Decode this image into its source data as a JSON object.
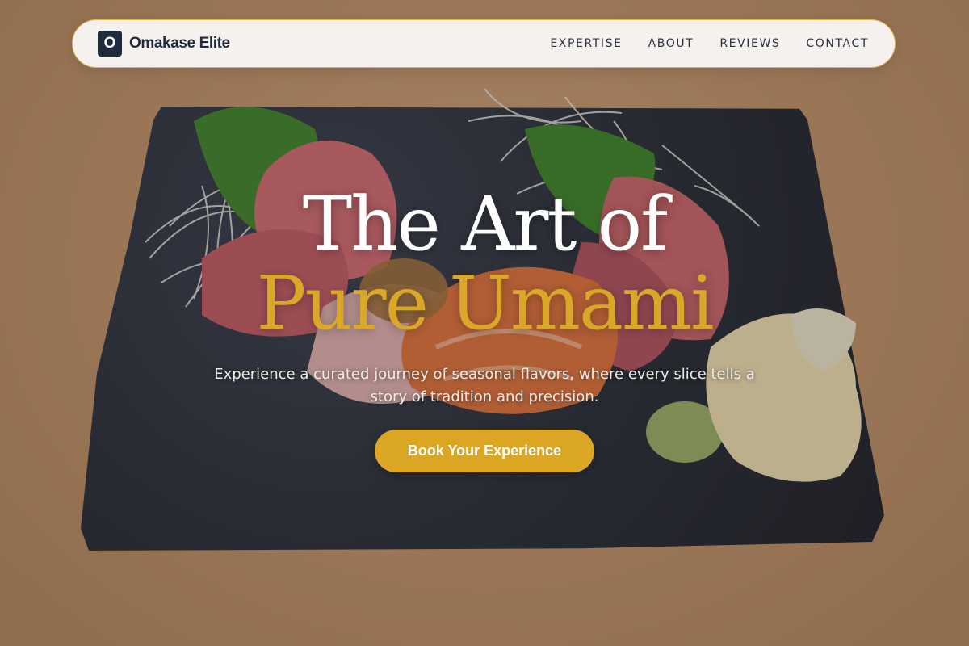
{
  "brand": {
    "logo_letter": "O",
    "name": "Omakase Elite"
  },
  "nav": {
    "items": [
      {
        "label": "EXPERTISE"
      },
      {
        "label": "ABOUT"
      },
      {
        "label": "REVIEWS"
      },
      {
        "label": "CONTACT"
      }
    ]
  },
  "hero": {
    "headline_line1": "The Art of",
    "headline_line2": "Pure Umami",
    "subtitle": "Experience a curated journey of seasonal flavors, where every slice tells a story of tradition and precision.",
    "cta_label": "Book Your Experience",
    "background_image": "sashimi-on-slate-plate"
  },
  "colors": {
    "accent": "#dba623",
    "nav_border": "#dcb54a",
    "brand_dark": "#1f2a3d",
    "nav_bg": "#f5f1ee"
  }
}
